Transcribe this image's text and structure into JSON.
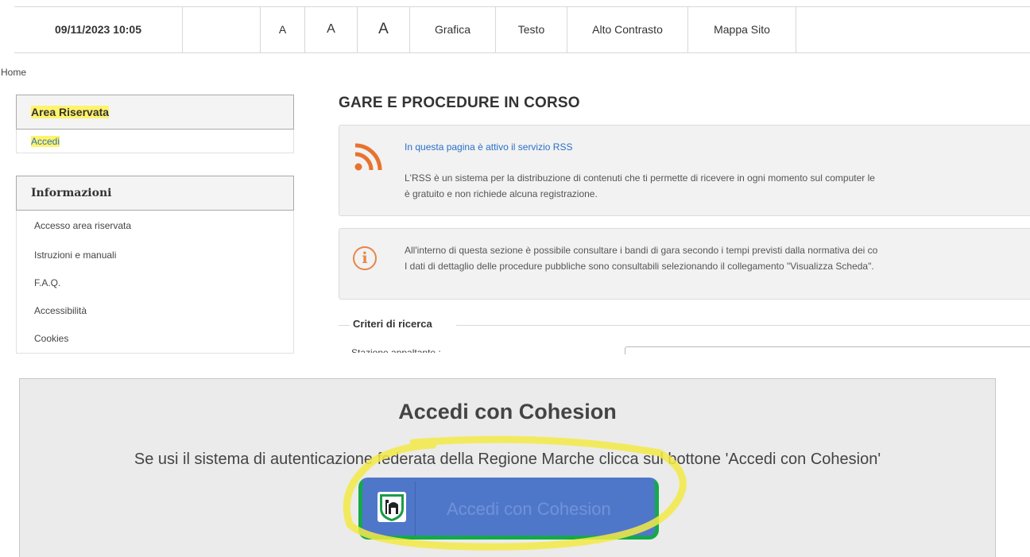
{
  "toolbar": {
    "datetime": "09/11/2023 10:05",
    "font_small": "A",
    "font_medium": "A",
    "font_large": "A",
    "grafica": "Grafica",
    "testo": "Testo",
    "alto_contrasto": "Alto Contrasto",
    "mappa_sito": "Mappa Sito"
  },
  "breadcrumb": {
    "home": "Home"
  },
  "sidebar": {
    "area_riservata": {
      "title": "Area Riservata",
      "accedi": "Accedi"
    },
    "informazioni": {
      "title": "Informazioni",
      "items": [
        {
          "label": "Accesso area riservata"
        },
        {
          "label": "Istruzioni e manuali"
        },
        {
          "label": "F.A.Q."
        },
        {
          "label": "Accessibilità"
        },
        {
          "label": "Cookies"
        }
      ]
    }
  },
  "main": {
    "title": "GARE E PROCEDURE IN CORSO",
    "rss": {
      "link": "In questa pagina è attivo il servizio RSS",
      "line1": "L'RSS è un sistema per la distribuzione di contenuti che ti permette di ricevere in ogni momento sul computer le",
      "line2": "è gratuito e non richiede alcuna registrazione."
    },
    "info": {
      "line1": "All'interno di questa sezione è possibile consultare i bandi di gara secondo i tempi previsti dalla normativa dei co",
      "line2": "I dati di dettaglio delle procedure pubbliche sono consultabili selezionando il collegamento \"Visualizza Scheda\"."
    },
    "criteri": {
      "legend": "Criteri di ricerca",
      "stazione_label": "Stazione appaltante :"
    }
  },
  "cohesion": {
    "title": "Accedi con Cohesion",
    "description": "Se usi il sistema di autenticazione federata della Regione Marche clicca sul bottone 'Accedi con Cohesion'",
    "button_label": "Accedi con Cohesion"
  },
  "colors": {
    "link": "#2a6fc8",
    "highlight": "#fff36b",
    "rss_orange": "#e8732e",
    "button_blue": "#4f77c9",
    "button_border_green": "#14a94b"
  }
}
